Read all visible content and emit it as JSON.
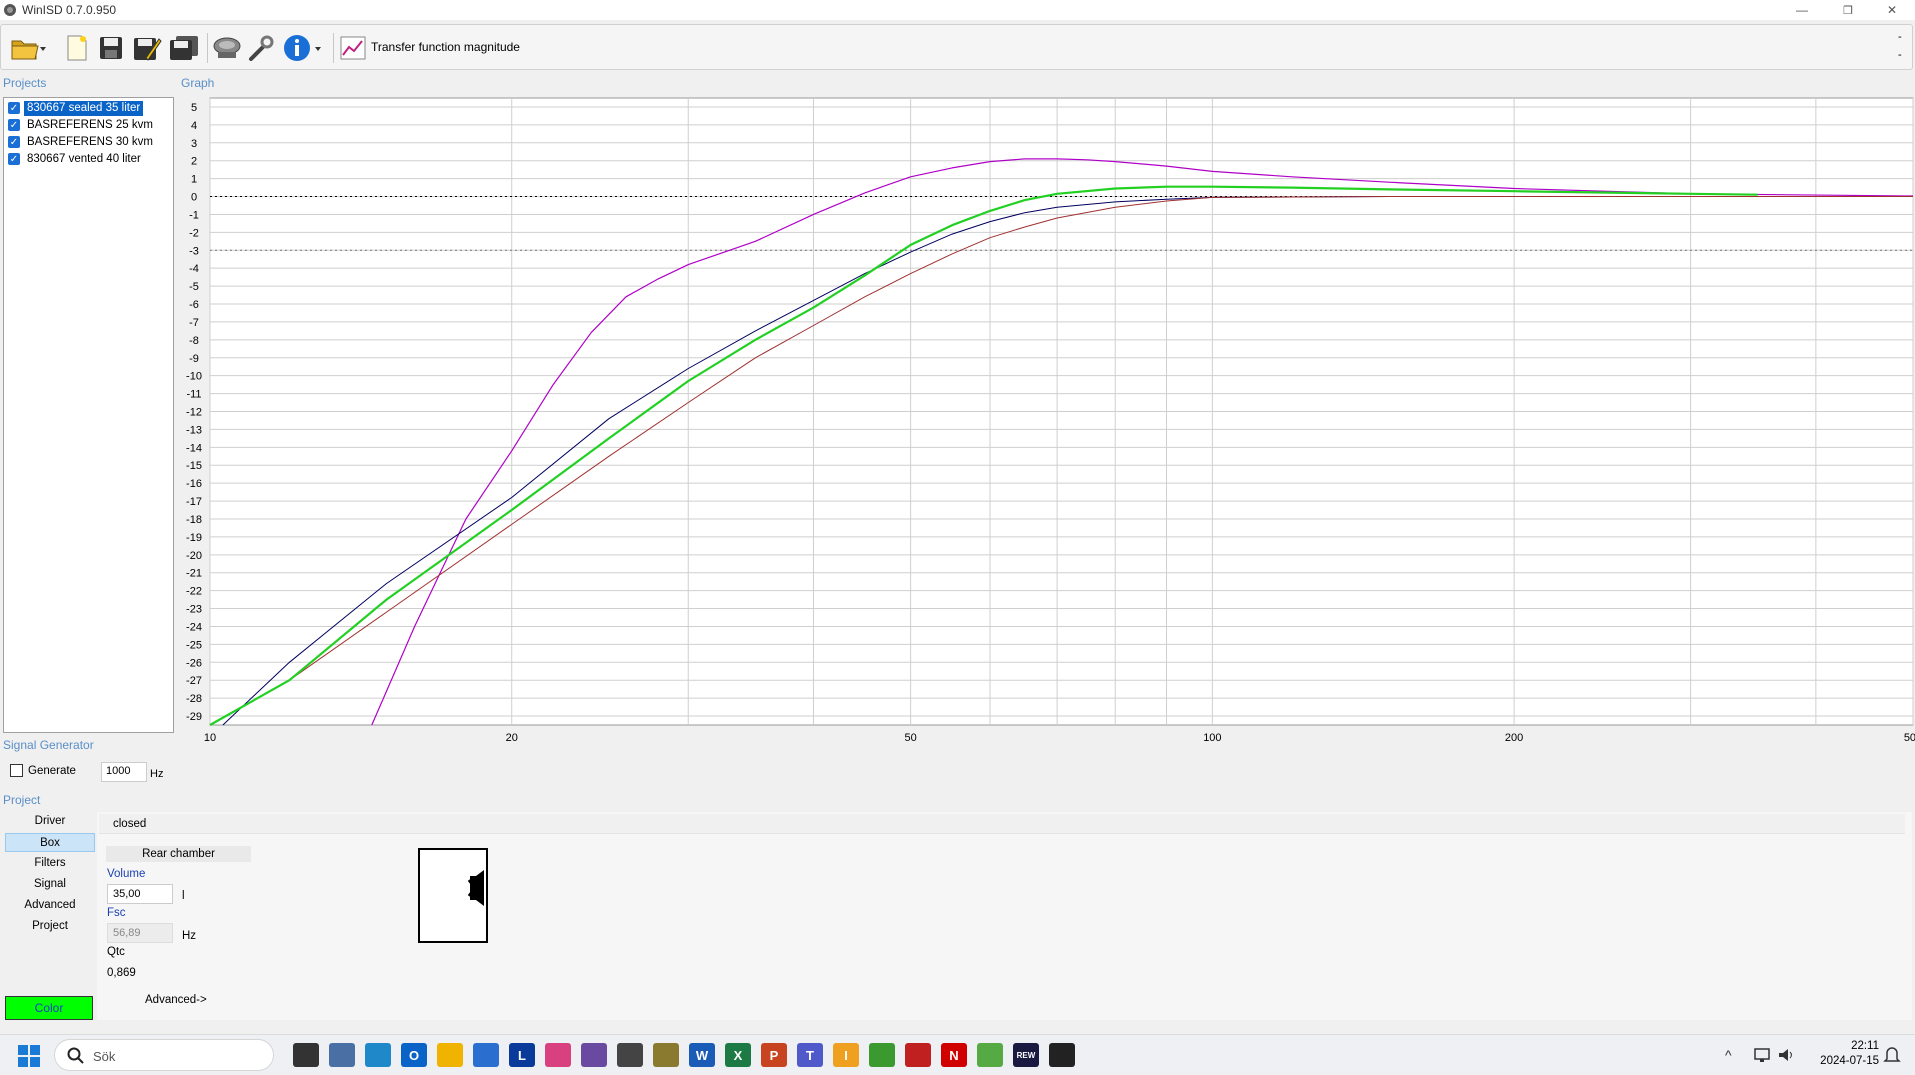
{
  "window": {
    "title": "WinISD 0.7.0.950",
    "minimize": "—",
    "restore": "❐",
    "close": "✕"
  },
  "toolbar": {
    "icons": [
      "open-folder-icon",
      "new-document-icon",
      "save-icon",
      "save-as-icon",
      "save-all-icon",
      "driver-speaker-icon",
      "tools-icon",
      "info-icon",
      "graph-icon"
    ],
    "graph_selector": "Transfer function magnitude",
    "dash_1": "-",
    "dash_2": "-"
  },
  "sections": {
    "projects": "Projects",
    "graph": "Graph",
    "signal_generator": "Signal Generator",
    "project": "Project"
  },
  "projects": [
    {
      "label": "830667 sealed 35 liter",
      "checked": true,
      "selected": true
    },
    {
      "label": "BASREFERENS 25 kvm",
      "checked": true,
      "selected": false
    },
    {
      "label": "BASREFERENS 30 kvm",
      "checked": true,
      "selected": false
    },
    {
      "label": "830667 vented 40 liter",
      "checked": true,
      "selected": false
    }
  ],
  "signal_generator": {
    "generate_label": "Generate",
    "frequency": "1000",
    "unit": "Hz"
  },
  "nav": [
    {
      "label": "Driver",
      "active": false
    },
    {
      "label": "Box",
      "active": true
    },
    {
      "label": "Filters",
      "active": false
    },
    {
      "label": "Signal",
      "active": false
    },
    {
      "label": "Advanced",
      "active": false
    },
    {
      "label": "Project",
      "active": false
    }
  ],
  "color_button": {
    "label": "Color",
    "color": "#00ff00"
  },
  "box_panel": {
    "type": "closed",
    "chamber_label": "Rear chamber",
    "volume_label": "Volume",
    "volume_value": "35,00",
    "volume_unit": "l",
    "fsc_label": "Fsc",
    "fsc_value": "56,89",
    "fsc_unit": "Hz",
    "qtc_label": "Qtc",
    "qtc_value": "0,869",
    "advanced_link": "Advanced->"
  },
  "chart_data": {
    "type": "line",
    "x_scale": "log",
    "xlim": [
      10,
      500
    ],
    "ylim": [
      -29.5,
      5.5
    ],
    "x_tick_labels": [
      {
        "value": 10,
        "label": "10"
      },
      {
        "value": 20,
        "label": "20"
      },
      {
        "value": 50,
        "label": "50"
      },
      {
        "value": 100,
        "label": "100"
      },
      {
        "value": 200,
        "label": "200"
      },
      {
        "value": 500,
        "label": "500"
      }
    ],
    "y_ticks": [
      5,
      4,
      3,
      2,
      1,
      0,
      -1,
      -2,
      -3,
      -4,
      -5,
      -6,
      -7,
      -8,
      -9,
      -10,
      -11,
      -12,
      -13,
      -14,
      -15,
      -16,
      -17,
      -18,
      -19,
      -20,
      -21,
      -22,
      -23,
      -24,
      -25,
      -26,
      -27,
      -28,
      -29
    ],
    "reference_lines": [
      {
        "y": 0,
        "style": "dotted",
        "color": "#000000"
      },
      {
        "y": -3,
        "style": "dotted",
        "color": "#777777"
      }
    ],
    "grid": true,
    "series": [
      {
        "color": "#b000c8",
        "width": 1.2,
        "points": [
          [
            14.5,
            -29.5
          ],
          [
            16,
            -24
          ],
          [
            18,
            -18
          ],
          [
            20,
            -14.2
          ],
          [
            22,
            -10.5
          ],
          [
            24,
            -7.6
          ],
          [
            26,
            -5.6
          ],
          [
            28,
            -4.6
          ],
          [
            30,
            -3.8
          ],
          [
            35,
            -2.5
          ],
          [
            40,
            -1
          ],
          [
            45,
            0.2
          ],
          [
            50,
            1.1
          ],
          [
            55,
            1.6
          ],
          [
            60,
            1.95
          ],
          [
            65,
            2.1
          ],
          [
            70,
            2.1
          ],
          [
            75,
            2.05
          ],
          [
            80,
            1.95
          ],
          [
            90,
            1.7
          ],
          [
            100,
            1.4
          ],
          [
            120,
            1.1
          ],
          [
            150,
            0.8
          ],
          [
            200,
            0.45
          ],
          [
            300,
            0.15
          ],
          [
            500,
            0.03
          ]
        ]
      },
      {
        "color": "#000060",
        "width": 1,
        "points": [
          [
            10.3,
            -29.5
          ],
          [
            12,
            -26
          ],
          [
            15,
            -21.6
          ],
          [
            20,
            -16.8
          ],
          [
            25,
            -12.4
          ],
          [
            30,
            -9.6
          ],
          [
            35,
            -7.5
          ],
          [
            40,
            -5.8
          ],
          [
            45,
            -4.3
          ],
          [
            50,
            -3.1
          ],
          [
            55,
            -2.1
          ],
          [
            60,
            -1.4
          ],
          [
            65,
            -0.9
          ],
          [
            70,
            -0.6
          ],
          [
            80,
            -0.3
          ],
          [
            90,
            -0.15
          ],
          [
            100,
            -0.05
          ],
          [
            150,
            0
          ],
          [
            500,
            0
          ]
        ]
      },
      {
        "color": "#a03030",
        "width": 1,
        "points": [
          [
            10,
            -29.5
          ],
          [
            12,
            -27
          ],
          [
            15,
            -23.2
          ],
          [
            20,
            -18.3
          ],
          [
            25,
            -14.5
          ],
          [
            30,
            -11.5
          ],
          [
            35,
            -9
          ],
          [
            40,
            -7.2
          ],
          [
            45,
            -5.6
          ],
          [
            50,
            -4.3
          ],
          [
            55,
            -3.2
          ],
          [
            60,
            -2.3
          ],
          [
            65,
            -1.7
          ],
          [
            70,
            -1.2
          ],
          [
            80,
            -0.6
          ],
          [
            90,
            -0.25
          ],
          [
            100,
            -0.05
          ],
          [
            150,
            0
          ],
          [
            500,
            0
          ]
        ]
      },
      {
        "color": "#22d022",
        "width": 2.2,
        "points": [
          [
            10,
            -29.5
          ],
          [
            12,
            -27
          ],
          [
            15,
            -22.5
          ],
          [
            20,
            -17.5
          ],
          [
            25,
            -13.5
          ],
          [
            30,
            -10.3
          ],
          [
            35,
            -8
          ],
          [
            40,
            -6.2
          ],
          [
            45,
            -4.4
          ],
          [
            50,
            -2.7
          ],
          [
            55,
            -1.6
          ],
          [
            60,
            -0.8
          ],
          [
            65,
            -0.2
          ],
          [
            70,
            0.15
          ],
          [
            80,
            0.45
          ],
          [
            90,
            0.55
          ],
          [
            100,
            0.55
          ],
          [
            120,
            0.5
          ],
          [
            150,
            0.4
          ],
          [
            200,
            0.3
          ],
          [
            300,
            0.15
          ],
          [
            350,
            0.1
          ]
        ]
      }
    ]
  },
  "taskbar": {
    "search_placeholder": "Sök",
    "apps": [
      {
        "icon": "task-view-icon",
        "text": "",
        "color": "#333333"
      },
      {
        "icon": "calculator-icon",
        "text": "",
        "color": "#4a6fa5"
      },
      {
        "icon": "edge-icon",
        "text": "",
        "color": "#1e88c8"
      },
      {
        "icon": "outlook-icon",
        "text": "O",
        "color": "#0a64c8"
      },
      {
        "icon": "file-explorer-icon",
        "text": "",
        "color": "#f0b400"
      },
      {
        "icon": "store-icon",
        "text": "",
        "color": "#2a6fd0"
      },
      {
        "icon": "l-app-icon",
        "text": "L",
        "color": "#0a3a9a"
      },
      {
        "icon": "snipping-tool-icon",
        "text": "",
        "color": "#d84080"
      },
      {
        "icon": "audio-app-icon",
        "text": "",
        "color": "#6a4aa0"
      },
      {
        "icon": "winisd-icon",
        "text": "",
        "color": "#444444"
      },
      {
        "icon": "media-app-icon",
        "text": "",
        "color": "#8a7a30"
      },
      {
        "icon": "word-icon",
        "text": "W",
        "color": "#1a5bb8"
      },
      {
        "icon": "excel-icon",
        "text": "X",
        "color": "#1d7a45"
      },
      {
        "icon": "powerpoint-icon",
        "text": "P",
        "color": "#c8431f"
      },
      {
        "icon": "teams-icon",
        "text": "T",
        "color": "#5059c9"
      },
      {
        "icon": "i-app-icon",
        "text": "I",
        "color": "#f0a020"
      },
      {
        "icon": "android-app-icon",
        "text": "",
        "color": "#3a9a30"
      },
      {
        "icon": "red-app-icon",
        "text": "",
        "color": "#c02020"
      },
      {
        "icon": "netflix-icon",
        "text": "N",
        "color": "#d00000"
      },
      {
        "icon": "torrent-icon",
        "text": "",
        "color": "#55aa44"
      },
      {
        "icon": "rew-icon",
        "text": "REW",
        "color": "#1a1a40"
      },
      {
        "icon": "capcut-icon",
        "text": "",
        "color": "#222222"
      }
    ],
    "tray_chevron": "^",
    "time": "22:11",
    "date": "2024-07-15"
  }
}
